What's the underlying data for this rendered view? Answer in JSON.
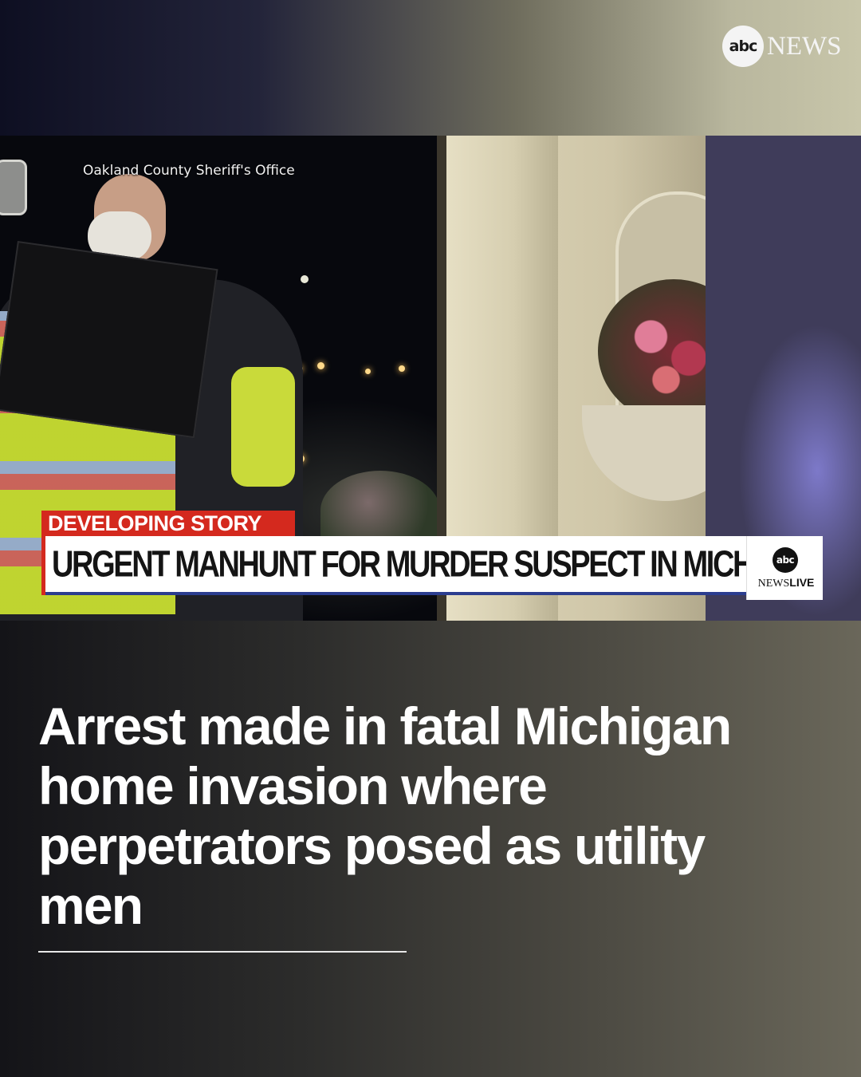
{
  "brand": {
    "logo_disc": "abc",
    "logo_word": "NEWS"
  },
  "video": {
    "credit": "Oakland County Sheriff's Office",
    "lower_third": {
      "tag": "DEVELOPING STORY",
      "headline": "URGENT MANHUNT FOR MURDER SUSPECT IN MICHIGAN",
      "badge_disc": "abc",
      "badge_news": "NEWS",
      "badge_live": "LIVE"
    }
  },
  "story": {
    "title": "Arrest made in fatal Michigan home invasion where perpetrators posed as utility men"
  },
  "colors": {
    "tag_red": "#d4291e",
    "headline_underline": "#2b3d8f",
    "text_white": "#ffffff"
  }
}
